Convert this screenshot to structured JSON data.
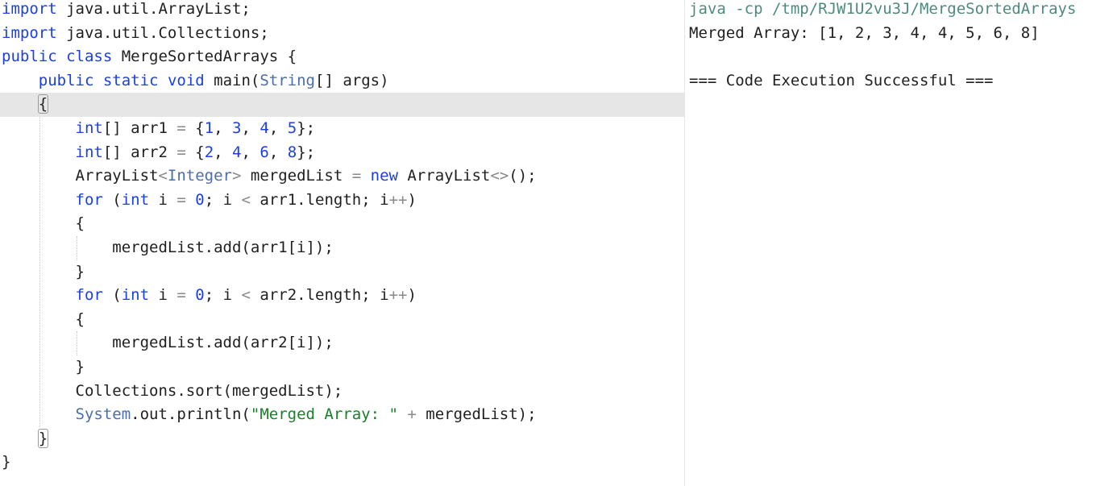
{
  "editor": {
    "language": "java",
    "lines": [
      {
        "tokens": [
          {
            "t": "import",
            "c": "kw"
          },
          {
            "t": " java.util.ArrayList;",
            "c": "plain"
          }
        ]
      },
      {
        "tokens": [
          {
            "t": "import",
            "c": "kw"
          },
          {
            "t": " java.util.Collections;",
            "c": "plain"
          }
        ]
      },
      {
        "tokens": [
          {
            "t": "public",
            "c": "kw"
          },
          {
            "t": " ",
            "c": "plain"
          },
          {
            "t": "class",
            "c": "kw"
          },
          {
            "t": " MergeSortedArrays {",
            "c": "plain"
          }
        ]
      },
      {
        "tokens": [
          {
            "t": "    ",
            "c": "plain"
          },
          {
            "t": "public",
            "c": "kw"
          },
          {
            "t": " ",
            "c": "plain"
          },
          {
            "t": "static",
            "c": "kw"
          },
          {
            "t": " ",
            "c": "plain"
          },
          {
            "t": "void",
            "c": "kw"
          },
          {
            "t": " main(",
            "c": "plain"
          },
          {
            "t": "String",
            "c": "ty"
          },
          {
            "t": "[] args)",
            "c": "plain"
          }
        ]
      },
      {
        "tokens": [
          {
            "t": "    ",
            "c": "plain"
          },
          {
            "t": "{",
            "c": "plain",
            "match": true
          }
        ],
        "active": true
      },
      {
        "tokens": [
          {
            "t": "        ",
            "c": "plain"
          },
          {
            "t": "int",
            "c": "kw"
          },
          {
            "t": "[] arr1 ",
            "c": "plain"
          },
          {
            "t": "=",
            "c": "op"
          },
          {
            "t": " {",
            "c": "plain"
          },
          {
            "t": "1",
            "c": "num"
          },
          {
            "t": ", ",
            "c": "plain"
          },
          {
            "t": "3",
            "c": "num"
          },
          {
            "t": ", ",
            "c": "plain"
          },
          {
            "t": "4",
            "c": "num"
          },
          {
            "t": ", ",
            "c": "plain"
          },
          {
            "t": "5",
            "c": "num"
          },
          {
            "t": "};",
            "c": "plain"
          }
        ]
      },
      {
        "tokens": [
          {
            "t": "        ",
            "c": "plain"
          },
          {
            "t": "int",
            "c": "kw"
          },
          {
            "t": "[] arr2 ",
            "c": "plain"
          },
          {
            "t": "=",
            "c": "op"
          },
          {
            "t": " {",
            "c": "plain"
          },
          {
            "t": "2",
            "c": "num"
          },
          {
            "t": ", ",
            "c": "plain"
          },
          {
            "t": "4",
            "c": "num"
          },
          {
            "t": ", ",
            "c": "plain"
          },
          {
            "t": "6",
            "c": "num"
          },
          {
            "t": ", ",
            "c": "plain"
          },
          {
            "t": "8",
            "c": "num"
          },
          {
            "t": "};",
            "c": "plain"
          }
        ]
      },
      {
        "tokens": [
          {
            "t": "        ",
            "c": "plain"
          },
          {
            "t": "ArrayList",
            "c": "plain"
          },
          {
            "t": "<",
            "c": "op"
          },
          {
            "t": "Integer",
            "c": "ty"
          },
          {
            "t": ">",
            "c": "op"
          },
          {
            "t": " mergedList ",
            "c": "plain"
          },
          {
            "t": "=",
            "c": "op"
          },
          {
            "t": " ",
            "c": "plain"
          },
          {
            "t": "new",
            "c": "kw"
          },
          {
            "t": " ArrayList",
            "c": "plain"
          },
          {
            "t": "<>",
            "c": "op"
          },
          {
            "t": "();",
            "c": "plain"
          }
        ]
      },
      {
        "tokens": [
          {
            "t": "        ",
            "c": "plain"
          },
          {
            "t": "for",
            "c": "kw"
          },
          {
            "t": " (",
            "c": "plain"
          },
          {
            "t": "int",
            "c": "kw"
          },
          {
            "t": " i ",
            "c": "plain"
          },
          {
            "t": "=",
            "c": "op"
          },
          {
            "t": " ",
            "c": "plain"
          },
          {
            "t": "0",
            "c": "num"
          },
          {
            "t": "; i ",
            "c": "plain"
          },
          {
            "t": "<",
            "c": "op"
          },
          {
            "t": " arr1.length; i",
            "c": "plain"
          },
          {
            "t": "++",
            "c": "op"
          },
          {
            "t": ")",
            "c": "plain"
          }
        ]
      },
      {
        "tokens": [
          {
            "t": "        {",
            "c": "plain"
          }
        ]
      },
      {
        "tokens": [
          {
            "t": "            mergedList.add(arr1[i]);",
            "c": "plain"
          }
        ]
      },
      {
        "tokens": [
          {
            "t": "        }",
            "c": "plain"
          }
        ]
      },
      {
        "tokens": [
          {
            "t": "        ",
            "c": "plain"
          },
          {
            "t": "for",
            "c": "kw"
          },
          {
            "t": " (",
            "c": "plain"
          },
          {
            "t": "int",
            "c": "kw"
          },
          {
            "t": " i ",
            "c": "plain"
          },
          {
            "t": "=",
            "c": "op"
          },
          {
            "t": " ",
            "c": "plain"
          },
          {
            "t": "0",
            "c": "num"
          },
          {
            "t": "; i ",
            "c": "plain"
          },
          {
            "t": "<",
            "c": "op"
          },
          {
            "t": " arr2.length; i",
            "c": "plain"
          },
          {
            "t": "++",
            "c": "op"
          },
          {
            "t": ")",
            "c": "plain"
          }
        ]
      },
      {
        "tokens": [
          {
            "t": "        {",
            "c": "plain"
          }
        ]
      },
      {
        "tokens": [
          {
            "t": "            mergedList.add(arr2[i]);",
            "c": "plain"
          }
        ]
      },
      {
        "tokens": [
          {
            "t": "        }",
            "c": "plain"
          }
        ]
      },
      {
        "tokens": [
          {
            "t": "        Collections.sort(mergedList);",
            "c": "plain"
          }
        ]
      },
      {
        "tokens": [
          {
            "t": "        ",
            "c": "plain"
          },
          {
            "t": "System",
            "c": "ty"
          },
          {
            "t": ".out.println(",
            "c": "plain"
          },
          {
            "t": "\"Merged Array: \"",
            "c": "str"
          },
          {
            "t": " ",
            "c": "plain"
          },
          {
            "t": "+",
            "c": "op"
          },
          {
            "t": " mergedList);",
            "c": "plain"
          }
        ]
      },
      {
        "tokens": [
          {
            "t": "    ",
            "c": "plain"
          },
          {
            "t": "}",
            "c": "plain",
            "match": true
          }
        ]
      },
      {
        "tokens": [
          {
            "t": "}",
            "c": "plain"
          }
        ]
      }
    ]
  },
  "output": {
    "command": "java -cp /tmp/RJW1U2vu3J/MergeSortedArrays",
    "result": "Merged Array: [1, 2, 3, 4, 4, 5, 6, 8]",
    "blank": "",
    "status": "=== Code Execution Successful ==="
  },
  "colors": {
    "keyword": "#1c3fe0",
    "type": "#4b6ea8",
    "number": "#1c3fe0",
    "string": "#1a7f2a",
    "operator": "#8a8a8a",
    "command": "#4e8a7e",
    "active_line": "#e6e6e6"
  }
}
